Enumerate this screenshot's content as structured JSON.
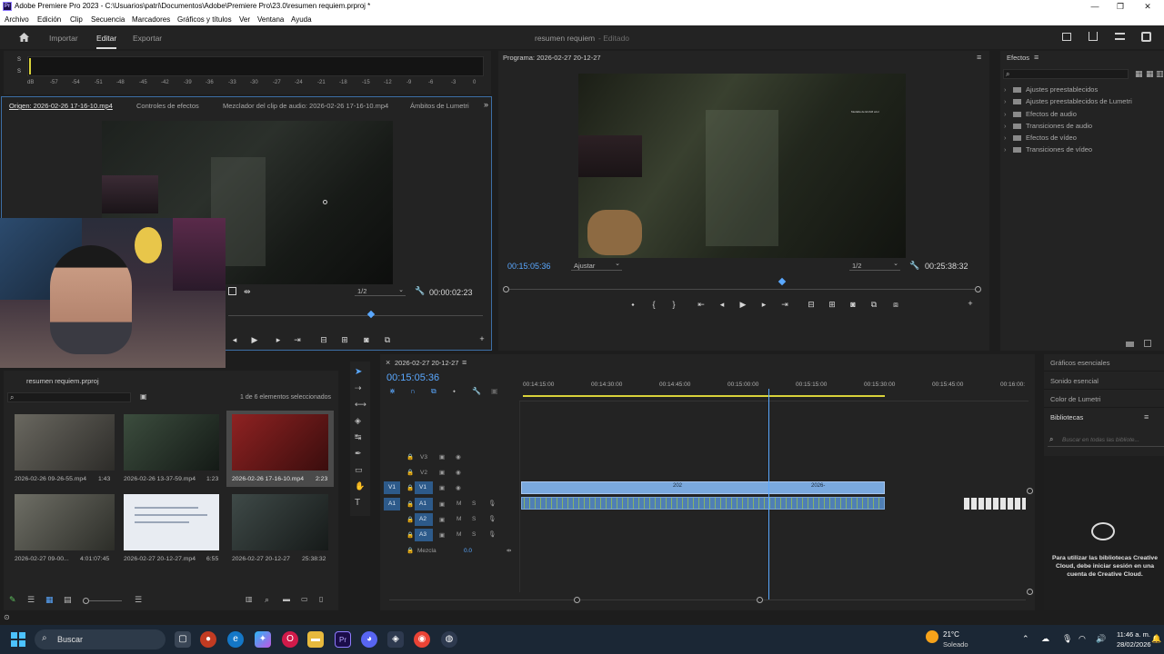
{
  "window": {
    "title": "Adobe Premiere Pro 2023 - C:\\Usuarios\\patri\\Documentos\\Adobe\\Premiere Pro\\23.0\\resumen requiem.prproj *",
    "logo_text": "Pr",
    "minimize": "—",
    "maximize": "❐",
    "close": "✕"
  },
  "menu": [
    "Archivo",
    "Edición",
    "Clip",
    "Secuencia",
    "Marcadores",
    "Gráficos y títulos",
    "Ver",
    "Ventana",
    "Ayuda"
  ],
  "header": {
    "tabs": [
      "Importar",
      "Editar",
      "Exportar"
    ],
    "active_tab": "Editar",
    "project_title": "resumen requiem",
    "status": "- Editado"
  },
  "audio_meter": {
    "labels": [
      "S",
      "S"
    ],
    "scale": [
      "dB",
      "-57",
      "-54",
      "-51",
      "-48",
      "-45",
      "-42",
      "-39",
      "-36",
      "-33",
      "-30",
      "-27",
      "-24",
      "-21",
      "-18",
      "-15",
      "-12",
      "-9",
      "-6",
      "-3",
      "0"
    ]
  },
  "source_panel": {
    "tabs": [
      "Origen: 2026-02-26 17-16-10.mp4",
      "Controles de efectos",
      "Mezclador del clip de audio: 2026-02-26 17-16-10.mp4",
      "Ámbitos de Lumetri"
    ],
    "resolution": "1/2",
    "duration": "00:00:02:23"
  },
  "program_panel": {
    "title": "Programa: 2026-02-27 20-12-27",
    "timecode": "00:15:05:36",
    "fit": "Ajustar",
    "resolution": "1/2",
    "duration": "00:25:38:32",
    "overlay_text": "Medalla de ECAM azul"
  },
  "effects_panel": {
    "title": "Efectos",
    "items": [
      "Ajustes preestablecidos",
      "Ajustes preestablecidos de Lumetri",
      "Efectos de audio",
      "Transiciones de audio",
      "Efectos de vídeo",
      "Transiciones de vídeo"
    ]
  },
  "project_panel": {
    "name": "resumen requiem.prproj",
    "selection": "1 de 6 elementos seleccionados",
    "items": [
      {
        "name": "2026-02-26 09-26-55.mp4",
        "duration": "1:43"
      },
      {
        "name": "2026-02-26 13-37-59.mp4",
        "duration": "1:23"
      },
      {
        "name": "2026-02-26 17-16-10.mp4",
        "duration": "2:23"
      },
      {
        "name": "2026-02-27 09-00...",
        "duration": "4:01:07:45"
      },
      {
        "name": "2026-02-27 20-12-27.mp4",
        "duration": "6:55"
      },
      {
        "name": "2026-02-27 20-12-27",
        "duration": "25:38:32"
      }
    ]
  },
  "timeline": {
    "sequence": "2026-02-27 20-12-27",
    "timecode": "00:15:05:36",
    "ruler": [
      "00:14:15:00",
      "00:14:30:00",
      "00:14:45:00",
      "00:15:00:00",
      "00:15:15:00",
      "00:15:30:00",
      "00:15:45:00",
      "00:16:00:"
    ],
    "video_tracks": [
      "V3",
      "V2",
      "V1"
    ],
    "audio_tracks": [
      "A1",
      "A2",
      "A3"
    ],
    "mix_label": "Mezcla",
    "mix_value": "0.0",
    "clip_label_1": "202",
    "clip_label_2": "2026-",
    "playhead_fraction": 0.49
  },
  "right_panels": {
    "items": [
      "Gráficos esenciales",
      "Sonido esencial",
      "Color de Lumetri",
      "Bibliotecas"
    ],
    "search_placeholder": "Buscar en todas las bibliote...",
    "cc_message": "Para utilizar las bibliotecas Creative Cloud, debe iniciar sesión en una cuenta de Creative Cloud."
  },
  "taskbar": {
    "search": "Buscar",
    "weather_temp": "21°C",
    "weather_desc": "Soleado",
    "time": "11:46 a. m.",
    "date": "28/02/2026"
  },
  "colors": {
    "accent_blue": "#4a9eff",
    "playhead": "#5aa8ff",
    "clip_video": "#7aa9de",
    "clip_audio": "#4f7fb5"
  }
}
